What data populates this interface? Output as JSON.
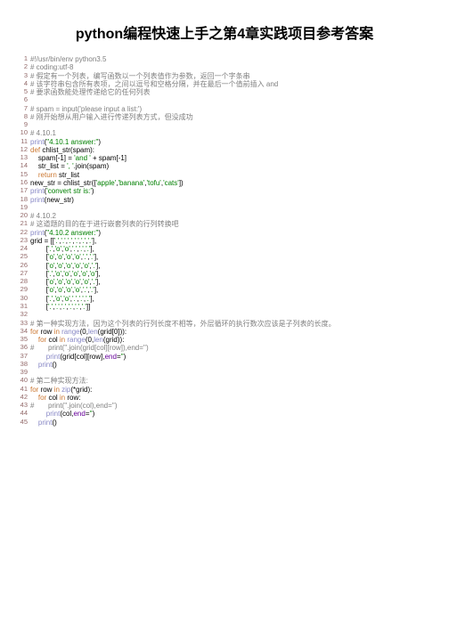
{
  "title": "python编程快速上手之第4章实践项目参考答案",
  "lines": [
    {
      "n": 1,
      "segs": [
        [
          "c-comment",
          "#!/usr/bin/env python3.5"
        ]
      ]
    },
    {
      "n": 2,
      "segs": [
        [
          "c-comment",
          "# coding:utf-8"
        ]
      ]
    },
    {
      "n": 3,
      "segs": [
        [
          "c-comment",
          "# 假定有一个列表，编写函数以一个列表值作为参数，返回一个字条串"
        ]
      ]
    },
    {
      "n": 4,
      "segs": [
        [
          "c-comment",
          "# 该字符串包含所有表项，之间以逗号和空格分隔，并在最后一个值前插入 and"
        ]
      ]
    },
    {
      "n": 5,
      "segs": [
        [
          "c-comment",
          "# 要求函数能处理传递给它的任何列表"
        ]
      ]
    },
    {
      "n": 6,
      "segs": [
        [
          "c-plain",
          ""
        ]
      ]
    },
    {
      "n": 7,
      "segs": [
        [
          "c-comment",
          "# spam = input('please input a list:')"
        ]
      ]
    },
    {
      "n": 8,
      "segs": [
        [
          "c-comment",
          "# 刚开始想从用户输入进行传递列表方式，但没成功"
        ]
      ]
    },
    {
      "n": 9,
      "segs": [
        [
          "c-plain",
          ""
        ]
      ]
    },
    {
      "n": 10,
      "segs": [
        [
          "c-comment",
          "# 4.10.1"
        ]
      ]
    },
    {
      "n": 11,
      "segs": [
        [
          "c-builtin",
          "print"
        ],
        [
          "c-plain",
          "("
        ],
        [
          "c-str",
          "\"4.10.1 answer:\""
        ],
        [
          "c-plain",
          ")"
        ]
      ]
    },
    {
      "n": 12,
      "segs": [
        [
          "c-kw",
          "def "
        ],
        [
          "c-fn",
          "chlist_str(spam):"
        ]
      ]
    },
    {
      "n": 13,
      "segs": [
        [
          "c-plain",
          "    spam[-"
        ],
        [
          "c-plain",
          "1"
        ],
        [
          "c-plain",
          "] = "
        ],
        [
          "c-str",
          "'and '"
        ],
        [
          "c-plain",
          " + spam[-"
        ],
        [
          "c-plain",
          "1"
        ],
        [
          "c-plain",
          "]"
        ]
      ]
    },
    {
      "n": 14,
      "segs": [
        [
          "c-plain",
          "    str_list = "
        ],
        [
          "c-str",
          "', '"
        ],
        [
          "c-plain",
          ".join(spam)"
        ]
      ]
    },
    {
      "n": 15,
      "segs": [
        [
          "c-plain",
          "    "
        ],
        [
          "c-kw",
          "return "
        ],
        [
          "c-plain",
          "str_list"
        ]
      ]
    },
    {
      "n": 16,
      "segs": [
        [
          "c-plain",
          "new_str = chlist_str(["
        ],
        [
          "c-str",
          "'apple'"
        ],
        [
          "c-plain",
          ","
        ],
        [
          "c-str",
          "'banana'"
        ],
        [
          "c-plain",
          ","
        ],
        [
          "c-str",
          "'tofu'"
        ],
        [
          "c-plain",
          ","
        ],
        [
          "c-str",
          "'cats'"
        ],
        [
          "c-plain",
          "])"
        ]
      ]
    },
    {
      "n": 17,
      "segs": [
        [
          "c-builtin",
          "print"
        ],
        [
          "c-plain",
          "("
        ],
        [
          "c-str",
          "'convert str is:'"
        ],
        [
          "c-plain",
          ")"
        ]
      ]
    },
    {
      "n": 18,
      "segs": [
        [
          "c-builtin",
          "print"
        ],
        [
          "c-plain",
          "(new_str)"
        ]
      ]
    },
    {
      "n": 19,
      "segs": [
        [
          "c-plain",
          ""
        ]
      ]
    },
    {
      "n": 20,
      "segs": [
        [
          "c-comment",
          "# 4.10.2"
        ]
      ]
    },
    {
      "n": 21,
      "segs": [
        [
          "c-comment",
          "# 这道题的目的在于进行嵌套列表的行列转换吧"
        ]
      ]
    },
    {
      "n": 22,
      "segs": [
        [
          "c-builtin",
          "print"
        ],
        [
          "c-plain",
          "("
        ],
        [
          "c-str",
          "\"4.10.2 answer:\""
        ],
        [
          "c-plain",
          ")"
        ]
      ]
    },
    {
      "n": 23,
      "segs": [
        [
          "c-plain",
          "grid = [["
        ],
        [
          "c-str",
          "'.'"
        ],
        [
          "c-plain",
          ","
        ],
        [
          "c-str",
          "'.'"
        ],
        [
          "c-plain",
          ","
        ],
        [
          "c-str",
          "'.'"
        ],
        [
          "c-plain",
          ","
        ],
        [
          "c-str",
          "'.'"
        ],
        [
          "c-plain",
          ","
        ],
        [
          "c-str",
          "'.'"
        ],
        [
          "c-plain",
          ","
        ],
        [
          "c-str",
          "'.'"
        ],
        [
          "c-plain",
          "],"
        ]
      ]
    },
    {
      "n": 24,
      "segs": [
        [
          "c-plain",
          "        ["
        ],
        [
          "c-str",
          "'.'"
        ],
        [
          "c-plain",
          ","
        ],
        [
          "c-str",
          "'o'"
        ],
        [
          "c-plain",
          ","
        ],
        [
          "c-str",
          "'o'"
        ],
        [
          "c-plain",
          ","
        ],
        [
          "c-str",
          "'.'"
        ],
        [
          "c-plain",
          ","
        ],
        [
          "c-str",
          "'.'"
        ],
        [
          "c-plain",
          ","
        ],
        [
          "c-str",
          "'.'"
        ],
        [
          "c-plain",
          "],"
        ]
      ]
    },
    {
      "n": 25,
      "segs": [
        [
          "c-plain",
          "        ["
        ],
        [
          "c-str",
          "'o'"
        ],
        [
          "c-plain",
          ","
        ],
        [
          "c-str",
          "'o'"
        ],
        [
          "c-plain",
          ","
        ],
        [
          "c-str",
          "'o'"
        ],
        [
          "c-plain",
          ","
        ],
        [
          "c-str",
          "'o'"
        ],
        [
          "c-plain",
          ","
        ],
        [
          "c-str",
          "'.'"
        ],
        [
          "c-plain",
          ","
        ],
        [
          "c-str",
          "'.'"
        ],
        [
          "c-plain",
          "],"
        ]
      ]
    },
    {
      "n": 26,
      "segs": [
        [
          "c-plain",
          "        ["
        ],
        [
          "c-str",
          "'o'"
        ],
        [
          "c-plain",
          ","
        ],
        [
          "c-str",
          "'o'"
        ],
        [
          "c-plain",
          ","
        ],
        [
          "c-str",
          "'o'"
        ],
        [
          "c-plain",
          ","
        ],
        [
          "c-str",
          "'o'"
        ],
        [
          "c-plain",
          ","
        ],
        [
          "c-str",
          "'o'"
        ],
        [
          "c-plain",
          ","
        ],
        [
          "c-str",
          "'.'"
        ],
        [
          "c-plain",
          "],"
        ]
      ]
    },
    {
      "n": 27,
      "segs": [
        [
          "c-plain",
          "        ["
        ],
        [
          "c-str",
          "'.'"
        ],
        [
          "c-plain",
          ","
        ],
        [
          "c-str",
          "'o'"
        ],
        [
          "c-plain",
          ","
        ],
        [
          "c-str",
          "'o'"
        ],
        [
          "c-plain",
          ","
        ],
        [
          "c-str",
          "'o'"
        ],
        [
          "c-plain",
          ","
        ],
        [
          "c-str",
          "'o'"
        ],
        [
          "c-plain",
          ","
        ],
        [
          "c-str",
          "'o'"
        ],
        [
          "c-plain",
          "],"
        ]
      ]
    },
    {
      "n": 28,
      "segs": [
        [
          "c-plain",
          "        ["
        ],
        [
          "c-str",
          "'o'"
        ],
        [
          "c-plain",
          ","
        ],
        [
          "c-str",
          "'o'"
        ],
        [
          "c-plain",
          ","
        ],
        [
          "c-str",
          "'o'"
        ],
        [
          "c-plain",
          ","
        ],
        [
          "c-str",
          "'o'"
        ],
        [
          "c-plain",
          ","
        ],
        [
          "c-str",
          "'o'"
        ],
        [
          "c-plain",
          ","
        ],
        [
          "c-str",
          "'.'"
        ],
        [
          "c-plain",
          "],"
        ]
      ]
    },
    {
      "n": 29,
      "segs": [
        [
          "c-plain",
          "        ["
        ],
        [
          "c-str",
          "'o'"
        ],
        [
          "c-plain",
          ","
        ],
        [
          "c-str",
          "'o'"
        ],
        [
          "c-plain",
          ","
        ],
        [
          "c-str",
          "'o'"
        ],
        [
          "c-plain",
          ","
        ],
        [
          "c-str",
          "'o'"
        ],
        [
          "c-plain",
          ","
        ],
        [
          "c-str",
          "'.'"
        ],
        [
          "c-plain",
          ","
        ],
        [
          "c-str",
          "'.'"
        ],
        [
          "c-plain",
          "],"
        ]
      ]
    },
    {
      "n": 30,
      "segs": [
        [
          "c-plain",
          "        ["
        ],
        [
          "c-str",
          "'.'"
        ],
        [
          "c-plain",
          ","
        ],
        [
          "c-str",
          "'o'"
        ],
        [
          "c-plain",
          ","
        ],
        [
          "c-str",
          "'o'"
        ],
        [
          "c-plain",
          ","
        ],
        [
          "c-str",
          "'.'"
        ],
        [
          "c-plain",
          ","
        ],
        [
          "c-str",
          "'.'"
        ],
        [
          "c-plain",
          ","
        ],
        [
          "c-str",
          "'.'"
        ],
        [
          "c-plain",
          "],"
        ]
      ]
    },
    {
      "n": 31,
      "segs": [
        [
          "c-plain",
          "        ["
        ],
        [
          "c-str",
          "'.'"
        ],
        [
          "c-plain",
          ","
        ],
        [
          "c-str",
          "'.'"
        ],
        [
          "c-plain",
          ","
        ],
        [
          "c-str",
          "'.'"
        ],
        [
          "c-plain",
          ","
        ],
        [
          "c-str",
          "'.'"
        ],
        [
          "c-plain",
          ","
        ],
        [
          "c-str",
          "'.'"
        ],
        [
          "c-plain",
          ","
        ],
        [
          "c-str",
          "'.'"
        ],
        [
          "c-plain",
          "]]"
        ]
      ]
    },
    {
      "n": 32,
      "segs": [
        [
          "c-plain",
          ""
        ]
      ]
    },
    {
      "n": 33,
      "segs": [
        [
          "c-comment",
          "# 第一种实现方法，因为这个列表的行列长度不相等，外层循环的执行数次应该是子列表的长度。"
        ]
      ]
    },
    {
      "n": 34,
      "segs": [
        [
          "c-kw",
          "for "
        ],
        [
          "c-plain",
          "row "
        ],
        [
          "c-kw",
          "in "
        ],
        [
          "c-builtin",
          "range"
        ],
        [
          "c-plain",
          "("
        ],
        [
          "c-plain",
          "0"
        ],
        [
          "c-plain",
          ","
        ],
        [
          "c-builtin",
          "len"
        ],
        [
          "c-plain",
          "(grid["
        ],
        [
          "c-plain",
          "0"
        ],
        [
          "c-plain",
          "])):"
        ]
      ]
    },
    {
      "n": 35,
      "segs": [
        [
          "c-plain",
          "    "
        ],
        [
          "c-kw",
          "for "
        ],
        [
          "c-plain",
          "col "
        ],
        [
          "c-kw",
          "in "
        ],
        [
          "c-builtin",
          "range"
        ],
        [
          "c-plain",
          "("
        ],
        [
          "c-plain",
          "0"
        ],
        [
          "c-plain",
          ","
        ],
        [
          "c-builtin",
          "len"
        ],
        [
          "c-plain",
          "(grid)):"
        ]
      ]
    },
    {
      "n": 36,
      "segs": [
        [
          "c-comment",
          "#       print(''.join(grid[col][row]),end='')"
        ]
      ]
    },
    {
      "n": 37,
      "segs": [
        [
          "c-plain",
          "        "
        ],
        [
          "c-builtin",
          "print"
        ],
        [
          "c-plain",
          "(grid[col][row],"
        ],
        [
          "c-attr",
          "end"
        ],
        [
          "c-plain",
          "="
        ],
        [
          "c-str",
          "''"
        ],
        [
          "c-plain",
          ")"
        ]
      ]
    },
    {
      "n": 38,
      "segs": [
        [
          "c-plain",
          "    "
        ],
        [
          "c-builtin",
          "print"
        ],
        [
          "c-plain",
          "()"
        ]
      ]
    },
    {
      "n": 39,
      "segs": [
        [
          "c-plain",
          ""
        ]
      ]
    },
    {
      "n": 40,
      "segs": [
        [
          "c-comment",
          "# 第二种实现方法:"
        ]
      ]
    },
    {
      "n": 41,
      "segs": [
        [
          "c-kw",
          "for "
        ],
        [
          "c-plain",
          "row "
        ],
        [
          "c-kw",
          "in "
        ],
        [
          "c-builtin",
          "zip"
        ],
        [
          "c-plain",
          "(*grid):"
        ]
      ]
    },
    {
      "n": 42,
      "segs": [
        [
          "c-plain",
          "    "
        ],
        [
          "c-kw",
          "for "
        ],
        [
          "c-plain",
          "col "
        ],
        [
          "c-kw",
          "in "
        ],
        [
          "c-plain",
          "row:"
        ]
      ]
    },
    {
      "n": 43,
      "segs": [
        [
          "c-comment",
          "#       print(''.join(col),end='')"
        ]
      ]
    },
    {
      "n": 44,
      "segs": [
        [
          "c-plain",
          "        "
        ],
        [
          "c-builtin",
          "print"
        ],
        [
          "c-plain",
          "(col,"
        ],
        [
          "c-attr",
          "end"
        ],
        [
          "c-plain",
          "="
        ],
        [
          "c-str",
          "''"
        ],
        [
          "c-plain",
          ")"
        ]
      ]
    },
    {
      "n": 45,
      "segs": [
        [
          "c-plain",
          "    "
        ],
        [
          "c-builtin",
          "print"
        ],
        [
          "c-plain",
          "()"
        ]
      ]
    }
  ]
}
